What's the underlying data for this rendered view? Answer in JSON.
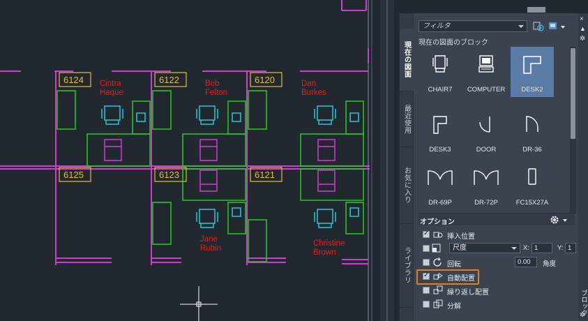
{
  "drawing": {
    "rooms": [
      "6124",
      "6122",
      "6120",
      "6125",
      "6123",
      "6121"
    ],
    "occupants": [
      {
        "first": "Cintra",
        "last": "Haque"
      },
      {
        "first": "Bob",
        "last": "Felton"
      },
      {
        "first": "Dan",
        "last": "Burkes"
      },
      {
        "first": "Jane",
        "last": "Rubin"
      },
      {
        "first": "Christine",
        "last": "Brown"
      }
    ]
  },
  "palette": {
    "tabs": [
      "現在の図面",
      "最近使用",
      "お気に入り",
      "ライブラリ"
    ],
    "filter_placeholder": "フィルタ",
    "section_title": "現在の図面のブロック",
    "blocks": [
      "CHAIR7",
      "COMPUTER",
      "DESK2",
      "DESK3",
      "DOOR",
      "DR-36",
      "DR-69P",
      "DR-72P",
      "FC15X27A"
    ],
    "selected_block": "DESK2",
    "options": {
      "title": "オプション",
      "insertion_point": "挿入位置",
      "scale_value": "尺度",
      "x_label": "X:",
      "x_value": "1",
      "y_label": "Y:",
      "y_value": "1",
      "rotation": "回転",
      "angle_value": "0.00",
      "angle_label": "角度",
      "auto_place": "自動配置",
      "repeat_place": "繰り返し配置",
      "explode": "分解"
    },
    "side_title": "ブロック",
    "checked": {
      "insertion_point": true,
      "scale": false,
      "rotation": false,
      "auto_place": true,
      "repeat_place": false,
      "explode": false
    }
  },
  "colors": {
    "background": "#212830",
    "wall": "#d23ad2",
    "furniture": "#1fd01f",
    "chair": "#2ac8d8",
    "label": "#e0c030",
    "name": "#e02020",
    "highlight": "#e47e20"
  }
}
